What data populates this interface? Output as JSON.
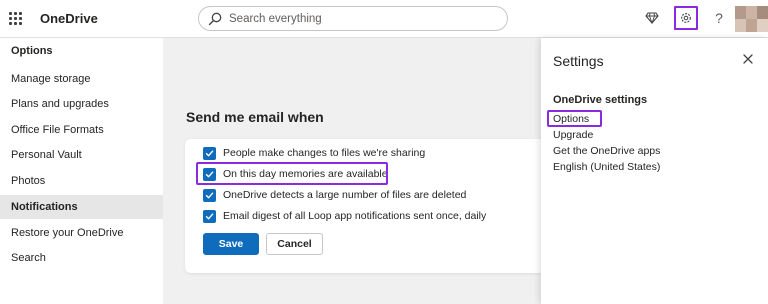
{
  "header": {
    "brand": "OneDrive",
    "search": {
      "placeholder": "Search everything",
      "value": ""
    },
    "icons": [
      "waffle-icon",
      "search-icon",
      "premium-diamond-icon",
      "gear-icon",
      "help-icon",
      "avatar"
    ],
    "help_label": "?"
  },
  "sidebar": {
    "title": "Options",
    "items": [
      {
        "label": "Manage storage",
        "active": false
      },
      {
        "label": "Plans and upgrades",
        "active": false
      },
      {
        "label": "Office File Formats",
        "active": false
      },
      {
        "label": "Personal Vault",
        "active": false
      },
      {
        "label": "Photos",
        "active": false
      },
      {
        "label": "Notifications",
        "active": true
      },
      {
        "label": "Restore your OneDrive",
        "active": false
      },
      {
        "label": "Search",
        "active": false
      }
    ]
  },
  "main": {
    "section_title": "Send me email when",
    "checkboxes": [
      {
        "label": "People make changes to files we're sharing",
        "checked": true
      },
      {
        "label": "On this day memories are available",
        "checked": true
      },
      {
        "label": "OneDrive detects a large number of files are deleted",
        "checked": true
      },
      {
        "label": "Email digest of all Loop app notifications sent once, daily",
        "checked": true
      }
    ],
    "save_label": "Save",
    "cancel_label": "Cancel"
  },
  "settings": {
    "title": "Settings",
    "subtitle": "OneDrive settings",
    "links": [
      "Options",
      "Upgrade",
      "Get the OneDrive apps",
      "English (United States)"
    ]
  },
  "colors": {
    "accent": "#0f6cbd",
    "highlight": "#8a2be2"
  }
}
